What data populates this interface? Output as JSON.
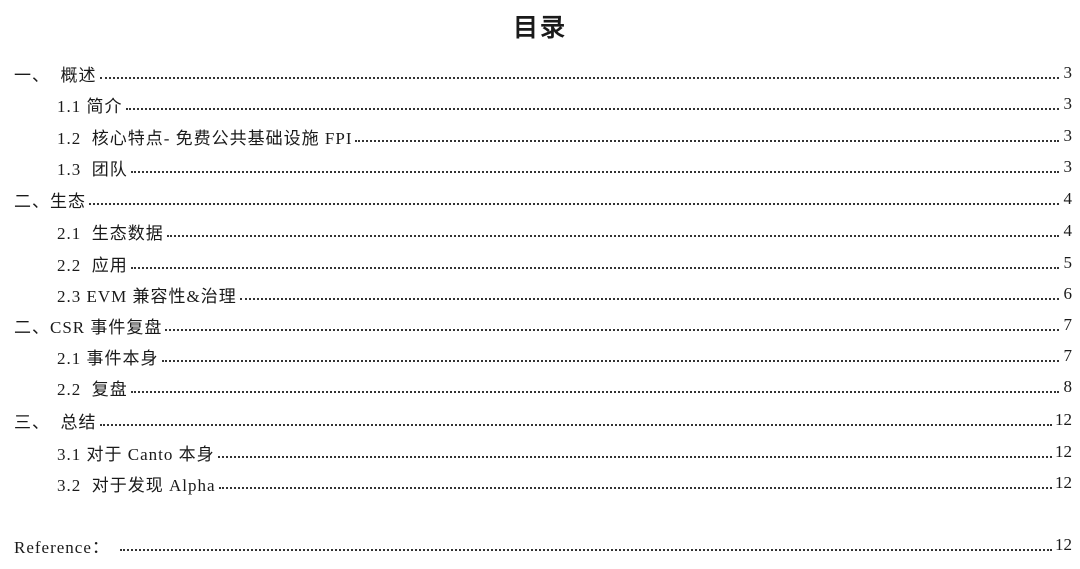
{
  "title": "目录",
  "entries": [
    {
      "label": "一、  概述",
      "page": "3",
      "level": 1
    },
    {
      "label": "1.1 简介",
      "page": "3",
      "level": 2
    },
    {
      "label": "1.2  核心特点- 免费公共基础设施 FPI",
      "page": "3",
      "level": 2
    },
    {
      "label": "1.3  团队",
      "page": "3",
      "level": 2
    },
    {
      "label": "二、生态",
      "page": "4",
      "level": 1
    },
    {
      "label": "2.1  生态数据",
      "page": "4",
      "level": 2
    },
    {
      "label": "2.2  应用",
      "page": "5",
      "level": 2
    },
    {
      "label": "2.3 EVM 兼容性&治理",
      "page": "6",
      "level": 2
    },
    {
      "label": "二、CSR 事件复盘",
      "page": "7",
      "level": 1
    },
    {
      "label": "2.1 事件本身",
      "page": "7",
      "level": 2
    },
    {
      "label": "2.2  复盘",
      "page": "8",
      "level": 2
    },
    {
      "label": "三、  总结",
      "page": "12",
      "level": 1
    },
    {
      "label": "3.1 对于 Canto 本身",
      "page": "12",
      "level": 2
    },
    {
      "label": "3.2  对于发现 Alpha",
      "page": "12",
      "level": 2
    }
  ],
  "reference": {
    "label": "Reference：",
    "page": "12"
  }
}
